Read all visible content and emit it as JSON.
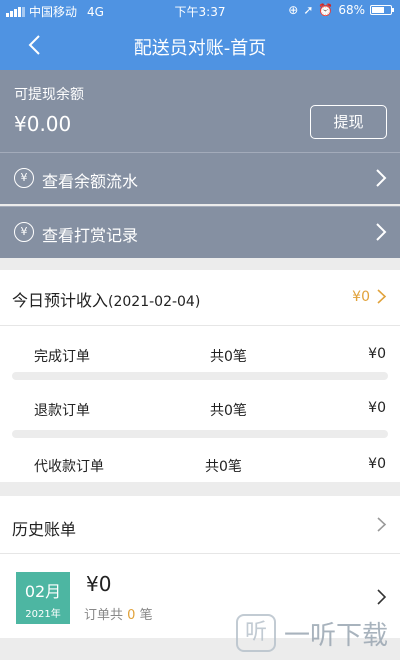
{
  "status_bar": {
    "carrier": "中国移动",
    "network": "4G",
    "time": "下午3:37",
    "battery": "68%",
    "battery_level": 0.68
  },
  "nav": {
    "title": "配送员对账-首页",
    "back_icon": "chevron-left-icon"
  },
  "balance": {
    "label": "可提现余额",
    "amount": "¥0.00",
    "withdraw_label": "提现"
  },
  "links": [
    {
      "icon": "¥",
      "label": "查看余额流水"
    },
    {
      "icon": "¥",
      "label": "查看打赏记录"
    }
  ],
  "today": {
    "title": "今日预计收入",
    "date": "(2021-02-04)",
    "amount": "¥0",
    "rows": [
      {
        "name": "完成订单",
        "count": "共0笔",
        "amount": "¥0"
      },
      {
        "name": "退款订单",
        "count": "共0笔",
        "amount": "¥0"
      },
      {
        "name": "代收款订单",
        "count": "共0笔",
        "amount": "¥0"
      }
    ]
  },
  "history": {
    "title": "历史账单",
    "month": {
      "month": "02月",
      "year": "2021年",
      "amount": "¥0",
      "count_prefix": "订单共",
      "count": "0",
      "count_suffix": "笔"
    }
  },
  "watermark": {
    "logo": "听",
    "text": "一听下载"
  },
  "colors": {
    "primary": "#4f93e2",
    "panel": "#8590a2",
    "accent": "#e1a23a",
    "badge": "#4db6a2"
  }
}
